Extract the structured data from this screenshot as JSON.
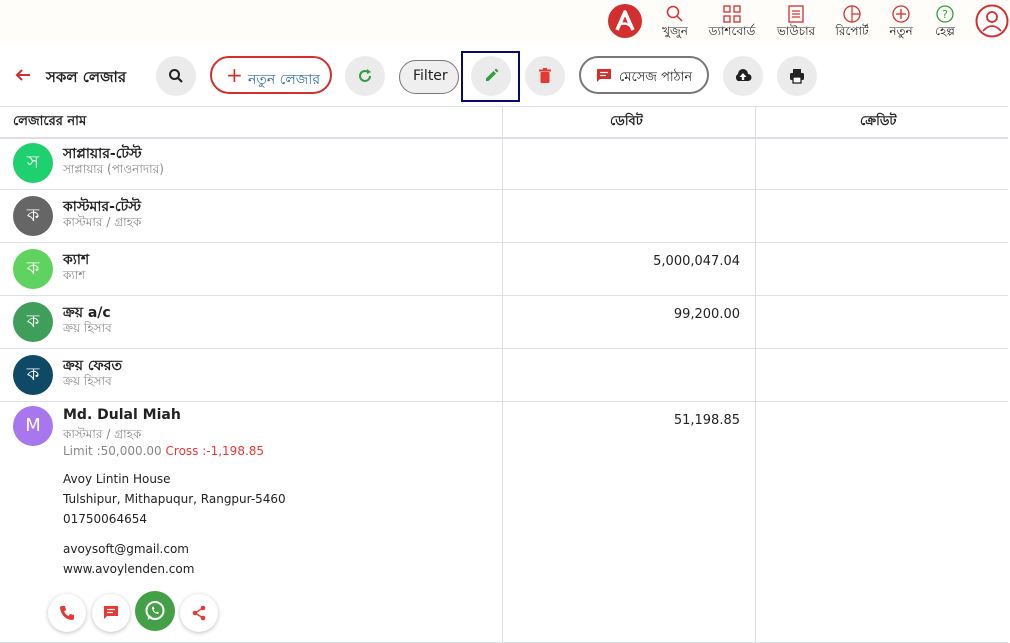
{
  "nav": {
    "items": [
      {
        "label": "খুজুন",
        "icon": "search-icon"
      },
      {
        "label": "ড্যাশবোর্ড",
        "icon": "dashboard-icon"
      },
      {
        "label": "ভাউচার",
        "icon": "voucher-icon"
      },
      {
        "label": "রিপোর্ট",
        "icon": "report-icon"
      },
      {
        "label": "নতুন",
        "icon": "add-circle-icon"
      },
      {
        "label": "হেল্প",
        "icon": "help-icon"
      }
    ],
    "accent": "#d32f2f"
  },
  "toolbar": {
    "title": "সকল লেজার",
    "new_ledger_label": "নতুন লেজার",
    "filter_label": "Filter",
    "message_label": "মেসেজ পাঠান"
  },
  "table": {
    "columns": [
      "লেজারের নাম",
      "ডেবিট",
      "ক্রেডিট"
    ],
    "rows": [
      {
        "initial": "স",
        "name": "সাপ্লায়ার-টেস্ট",
        "sub": "সাপ্লায়ার (পাওনাদার)",
        "debit": "",
        "credit": "",
        "color": "#1fd06e"
      },
      {
        "initial": "ক",
        "name": "কাস্টমার-টেস্ট",
        "sub": "কাস্টমার / গ্রাহক",
        "debit": "",
        "credit": "",
        "color": "#666666"
      },
      {
        "initial": "ক",
        "name": "ক্যাশ",
        "sub": "ক্যাশ",
        "debit": "5,000,047.04",
        "credit": "",
        "color": "#5fd35f"
      },
      {
        "initial": "ক",
        "name": "ক্রয় a/c",
        "sub": "ক্রয় হিসাব",
        "debit": "99,200.00",
        "credit": "",
        "color": "#3f9e5a"
      },
      {
        "initial": "ক",
        "name": "ক্রয় ফেরত",
        "sub": "ক্রয় হিসাব",
        "debit": "",
        "credit": "",
        "color": "#0e4a66"
      },
      {
        "initial": "M",
        "name": "Md. Dulal Miah",
        "sub": "কাস্টমার / গ্রাহক",
        "debit": "51,198.85",
        "credit": "",
        "color": "#a877f0",
        "limit": "Limit :50,000.00",
        "cross": "Cross :-1,198.85",
        "address1": "Avoy Lintin House",
        "address2": "Tulshipur, Mithapuqur, Rangpur-5460",
        "phone": "01750064654",
        "email": "avoysoft@gmail.com",
        "website": "www.avoylenden.com"
      }
    ]
  }
}
